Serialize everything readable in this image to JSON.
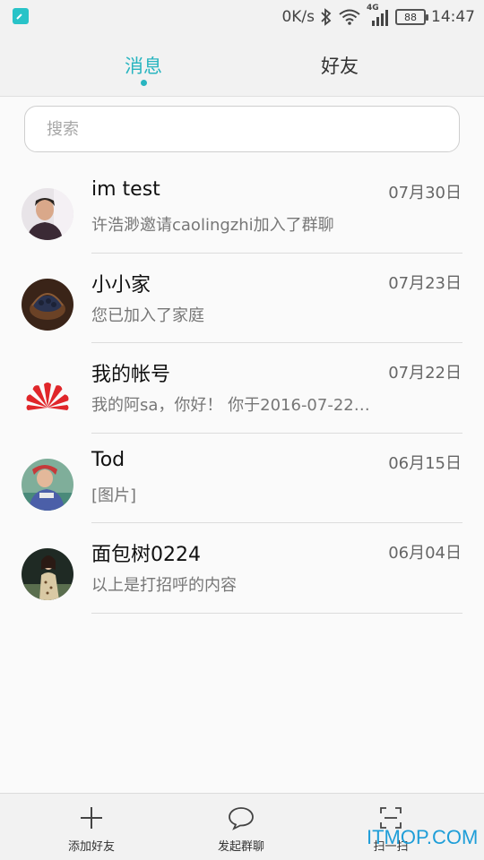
{
  "status_bar": {
    "net_speed": "0K/s",
    "network_type": "4G",
    "battery": "88",
    "time": "14:47"
  },
  "tabs": {
    "messages": "消息",
    "friends": "好友"
  },
  "search": {
    "placeholder": "搜索"
  },
  "conversations": [
    {
      "name": "im test",
      "date": "07月30日",
      "preview": "许浩渺邀请caolingzhi加入了群聊"
    },
    {
      "name": "小小家",
      "date": "07月23日",
      "preview": "您已加入了家庭"
    },
    {
      "name": "我的帐号",
      "date": "07月22日",
      "preview": "我的阿sa，你好！ 你于2016-07-22…"
    },
    {
      "name": "Tod",
      "date": "06月15日",
      "preview": "[图片]"
    },
    {
      "name": "面包树0224",
      "date": "06月04日",
      "preview": "以上是打招呼的内容"
    }
  ],
  "bottom_nav": {
    "add_friend": "添加好友",
    "group_chat": "发起群聊",
    "scan": "扫一扫"
  },
  "watermark": "ITMOP.COM",
  "colors": {
    "accent": "#29b5c0",
    "huawei_red": "#e0262a"
  }
}
